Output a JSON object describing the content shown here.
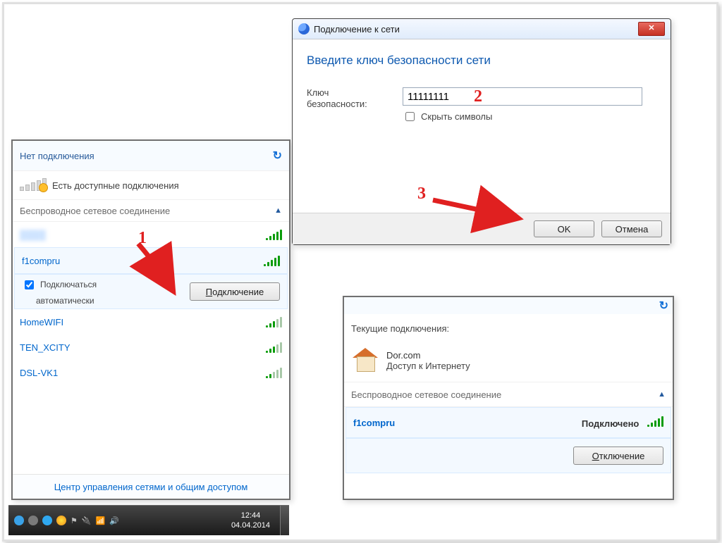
{
  "annotations": {
    "n1": "1",
    "n2": "2",
    "n3": "3"
  },
  "flyout": {
    "title": "Нет подключения",
    "available": "Есть доступные подключения",
    "section": "Беспроводное сетевое соединение",
    "connect_btn": "Подключение",
    "auto_top": "Подключаться",
    "auto_bottom": "автоматически",
    "footer": "Центр управления сетями и общим доступом",
    "networks": [
      "",
      "f1compru",
      "HomeWIFI",
      "TEN_XCITY",
      "DSL-VK1"
    ]
  },
  "keydlg": {
    "title": "Подключение к сети",
    "prompt": "Введите ключ безопасности сети",
    "label_top": "Ключ",
    "label_bottom": "безопасности:",
    "value": "11111111",
    "hide": "Скрыть символы",
    "ok": "OK",
    "cancel": "Отмена"
  },
  "curr": {
    "title": "Текущие подключения:",
    "domain": "Dor.com",
    "status": "Доступ к Интернету",
    "section": "Беспроводное сетевое соединение",
    "name": "f1compru",
    "state": "Подключено",
    "disconnect": "Отключение"
  },
  "taskbar": {
    "time": "12:44",
    "date": "04.04.2014"
  }
}
